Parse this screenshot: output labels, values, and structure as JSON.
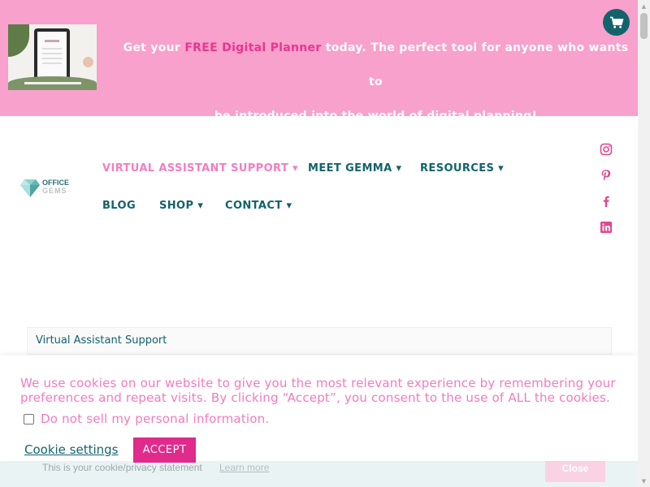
{
  "promo": {
    "line1_before": "Get your ",
    "line1_highlight": "FREE Digital Planner",
    "line1_after": " today. The perfect tool for anyone who wants to",
    "line2": "be introduced into the world of digital planning!",
    "thumbnail_icon": "digital-planner-tablet-image",
    "cart_icon": "cart-icon"
  },
  "logo": {
    "line1": "OFFICE",
    "line2": "GEMS"
  },
  "nav": {
    "items": [
      {
        "label": "VIRTUAL ASSISTANT SUPPORT ▾",
        "active": true
      },
      {
        "label": "MEET GEMMA ▾",
        "active": false
      },
      {
        "label": "RESOURCES ▾",
        "active": false
      },
      {
        "label": "BLOG",
        "active": false
      },
      {
        "label": "SHOP ▾",
        "active": false
      },
      {
        "label": "CONTACT ▾",
        "active": false
      }
    ]
  },
  "social": {
    "icons": [
      "instagram-icon",
      "pinterest-icon",
      "facebook-icon",
      "linkedin-icon"
    ]
  },
  "breadcrumb": {
    "text": "Virtual Assistant Support"
  },
  "notice": {
    "text": "This is your cookie/privacy statement",
    "link": "Learn more",
    "close": "Close"
  },
  "cookie": {
    "message": "We use cookies on our website to give you the most relevant experience by remembering your preferences and repeat visits. By clicking “Accept”, you consent to the use of ALL the cookies.",
    "dns_label": "Do not sell my personal information.",
    "settings_label": "Cookie settings",
    "accept_label": "ACCEPT"
  },
  "colors": {
    "banner_pink": "#f7a1cc",
    "highlight_pink": "#e8368f",
    "teal": "#12636c",
    "nav_active": "#f27ec2",
    "social_pink": "#e0478f",
    "accept_bg": "#e02a8c",
    "cookie_text": "#f07cbf"
  }
}
